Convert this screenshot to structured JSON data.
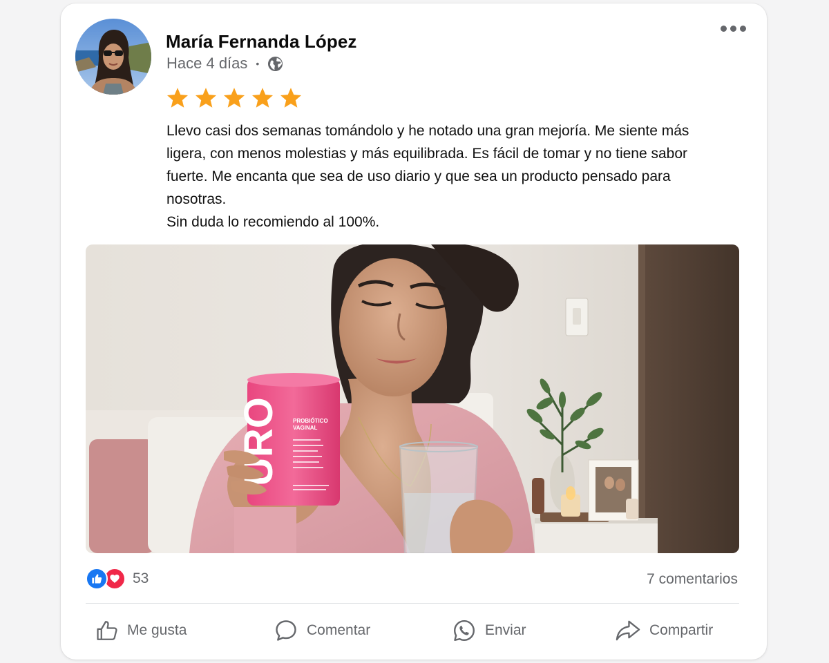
{
  "post": {
    "author": "María Fernanda López",
    "time_ago": "Hace 4 días",
    "separator": "•",
    "visibility_icon": "globe-icon",
    "rating": 5,
    "review_lines": [
      "Llevo casi dos semanas tomándolo y he notado una gran mejoría. Me siente más ligera, con menos molestias y más equilibrada. Es fácil de tomar y no tiene sabor fuerte. Me encanta que sea de uso diario y que sea un producto pensado para nosotras.",
      "Sin duda lo recomiendo al 100%."
    ],
    "photo": {
      "product_brand": "URO",
      "product_name": "PROBIÓTICO VAGINAL"
    }
  },
  "reactions": {
    "count": "53",
    "types": [
      "like-icon",
      "love-icon"
    ],
    "like_color": "#1877f2",
    "love_color": "#f02849"
  },
  "comments_label": "7 comentarios",
  "actions": {
    "like": "Me gusta",
    "comment": "Comentar",
    "send": "Enviar",
    "share": "Compartir"
  },
  "colors": {
    "star": "#f9a01b",
    "muted_text": "#65676b",
    "product_pink": "#ea5a8f"
  }
}
